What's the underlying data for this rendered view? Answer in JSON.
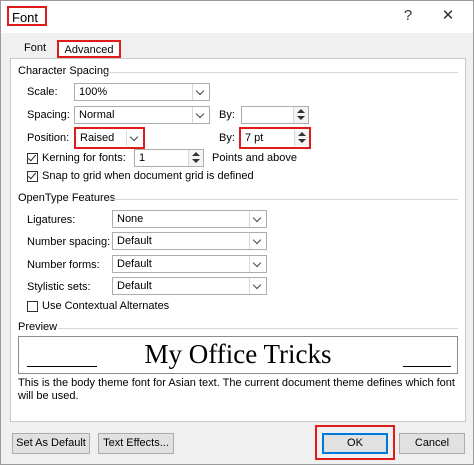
{
  "window": {
    "title": "Font",
    "help_glyph": "?",
    "close_glyph": "✕"
  },
  "tabs": [
    {
      "label": "Font"
    },
    {
      "label": "Advanced"
    }
  ],
  "character_spacing": {
    "heading": "Character Spacing",
    "scale": {
      "label": "Scale:",
      "value": "100%"
    },
    "spacing": {
      "label": "Spacing:",
      "value": "Normal",
      "by_label": "By:",
      "by_value": ""
    },
    "position": {
      "label": "Position:",
      "value": "Raised",
      "by_label": "By:",
      "by_value": "7 pt"
    },
    "kerning": {
      "label": "Kerning for fonts:",
      "value": "1",
      "suffix": "Points and above",
      "checked": true
    },
    "snap": {
      "label": "Snap to grid when document grid is defined",
      "checked": true
    }
  },
  "opentype": {
    "heading": "OpenType Features",
    "ligatures": {
      "label": "Ligatures:",
      "value": "None"
    },
    "number_spacing": {
      "label": "Number spacing:",
      "value": "Default"
    },
    "number_forms": {
      "label": "Number forms:",
      "value": "Default"
    },
    "stylistic_sets": {
      "label": "Stylistic sets:",
      "value": "Default"
    },
    "contextual": {
      "label": "Use Contextual Alternates",
      "checked": false
    }
  },
  "preview": {
    "heading": "Preview",
    "sample": "My Office Tricks",
    "note": "This is the body theme font for Asian text. The current document theme defines which font will be used."
  },
  "buttons": {
    "set_default": "Set As Default",
    "text_effects": "Text Effects...",
    "ok": "OK",
    "cancel": "Cancel"
  },
  "colors": {
    "highlight": "#e01b1b",
    "focus": "#0078d7"
  }
}
